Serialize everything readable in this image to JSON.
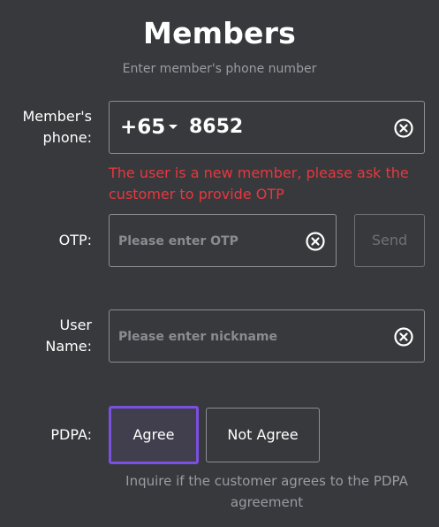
{
  "header": {
    "title": "Members",
    "subtitle": "Enter member's phone number"
  },
  "phone": {
    "label_line1": "Member's",
    "label_line2": "phone:",
    "country_code": "+65",
    "value": "8652",
    "error": "The user is a new member, please ask the customer to provide OTP"
  },
  "otp": {
    "label": "OTP:",
    "placeholder": "Please enter OTP",
    "send_label": "Send"
  },
  "username": {
    "label_line1": "User",
    "label_line2": "Name:",
    "placeholder": "Please enter nickname"
  },
  "pdpa": {
    "label": "PDPA:",
    "agree_label": "Agree",
    "not_agree_label": "Not Agree",
    "selected": "Agree",
    "note": "Inquire if the customer agrees to the PDPA agreement"
  },
  "icons": {
    "clear": "clear-circle-x-icon",
    "dropdown": "caret-down-icon"
  },
  "colors": {
    "background": "#38393c",
    "error": "#e8373f",
    "accent": "#7b4fe0",
    "muted": "#9a9ca3"
  }
}
